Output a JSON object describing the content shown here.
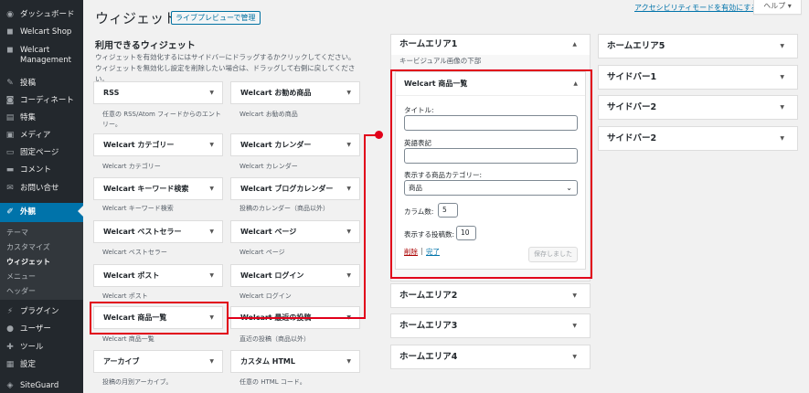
{
  "sidebar": {
    "items": [
      {
        "label": "ダッシュボード",
        "icon": "dashboard-icon",
        "glyph": "◉"
      },
      {
        "label": "Welcart Shop",
        "icon": "shop-icon",
        "glyph": "◼"
      },
      {
        "label": "Welcart Management",
        "icon": "management-icon",
        "glyph": "◼"
      },
      {
        "label": "投稿",
        "icon": "pin-icon",
        "glyph": "✎"
      },
      {
        "label": "コーディネート",
        "icon": "camera-icon",
        "glyph": "◙"
      },
      {
        "label": "特集",
        "icon": "feature-icon",
        "glyph": "▤"
      },
      {
        "label": "メディア",
        "icon": "media-icon",
        "glyph": "▣"
      },
      {
        "label": "固定ページ",
        "icon": "page-icon",
        "glyph": "▭"
      },
      {
        "label": "コメント",
        "icon": "comment-icon",
        "glyph": "▬"
      },
      {
        "label": "お問い合せ",
        "icon": "mail-icon",
        "glyph": "✉"
      },
      {
        "label": "外観",
        "icon": "brush-icon",
        "glyph": "✐"
      },
      {
        "label": "プラグイン",
        "icon": "plugin-icon",
        "glyph": "⚡"
      },
      {
        "label": "ユーザー",
        "icon": "user-icon",
        "glyph": "●"
      },
      {
        "label": "ツール",
        "icon": "wrench-icon",
        "glyph": "✚"
      },
      {
        "label": "設定",
        "icon": "settings-icon",
        "glyph": "▦"
      },
      {
        "label": "SiteGuard",
        "icon": "shield-icon",
        "glyph": "◈"
      }
    ],
    "submenu": [
      "テーマ",
      "カスタマイズ",
      "ウィジェット",
      "メニュー",
      "ヘッダー"
    ]
  },
  "header": {
    "title": "ウィジェット",
    "manage_label": "ライブプレビューで管理",
    "a11y_link": "アクセシビリティモードを有効にする",
    "help_label": "ヘルプ ▾"
  },
  "available": {
    "title": "利用できるウィジェット",
    "description": "ウィジェットを有効化するにはサイドバーにドラッグするかクリックしてください。ウィジェットを無効化し設定を削除したい場合は、ドラッグして右側に戻してください。",
    "widgets": [
      {
        "name": "RSS",
        "desc": "任意の RSS/Atom フィードからのエントリー。"
      },
      {
        "name": "Welcart お勧め商品",
        "desc": "Welcart お勧め商品"
      },
      {
        "name": "Welcart カテゴリー",
        "desc": "Welcart カテゴリー"
      },
      {
        "name": "Welcart カレンダー",
        "desc": "Welcart カレンダー"
      },
      {
        "name": "Welcart キーワード検索",
        "desc": "Welcart キーワード検索"
      },
      {
        "name": "Welcart ブログカレンダー",
        "desc": "投稿のカレンダー（商品以外）"
      },
      {
        "name": "Welcart ベストセラー",
        "desc": "Welcart ベストセラー"
      },
      {
        "name": "Welcart ページ",
        "desc": "Welcart ページ"
      },
      {
        "name": "Welcart ポスト",
        "desc": "Welcart ポスト"
      },
      {
        "name": "Welcart ログイン",
        "desc": "Welcart ログイン"
      },
      {
        "name": "Welcart 商品一覧",
        "desc": "Welcart 商品一覧"
      },
      {
        "name": "Welcart 最近の投稿",
        "desc": "直近の投稿（商品以外）"
      },
      {
        "name": "アーカイブ",
        "desc": "投稿の月別アーカイブ。"
      },
      {
        "name": "カスタム HTML",
        "desc": "任意の HTML コード。"
      }
    ]
  },
  "areas": {
    "home1": {
      "name": "ホームエリア1",
      "desc": "キービジュアル画像の下部"
    },
    "home2": "ホームエリア2",
    "home3": "ホームエリア3",
    "home4": "ホームエリア4",
    "home5": "ホームエリア5",
    "sidebar1": "サイドバー1",
    "sidebar2a": "サイドバー2",
    "sidebar2b": "サイドバー2"
  },
  "open_widget": {
    "title": "Welcart 商品一覧",
    "title_label": "タイトル:",
    "title_value": "",
    "english_label": "英語表記",
    "english_value": "",
    "category_label": "表示する商品カテゴリー:",
    "category_value": "商品",
    "columns_label": "カラム数:",
    "columns_value": "5",
    "posts_label": "表示する投稿数:",
    "posts_value": "10",
    "delete_label": "削除",
    "separator": "|",
    "done_label": "完了",
    "save_label": "保存しました"
  },
  "icons": {
    "arrow_down": "▼",
    "arrow_up": "▲",
    "chevron": "⌄"
  },
  "colors": {
    "sidebar_bg": "#23282d",
    "active": "#0073aa",
    "annotation": "#e1001a"
  }
}
